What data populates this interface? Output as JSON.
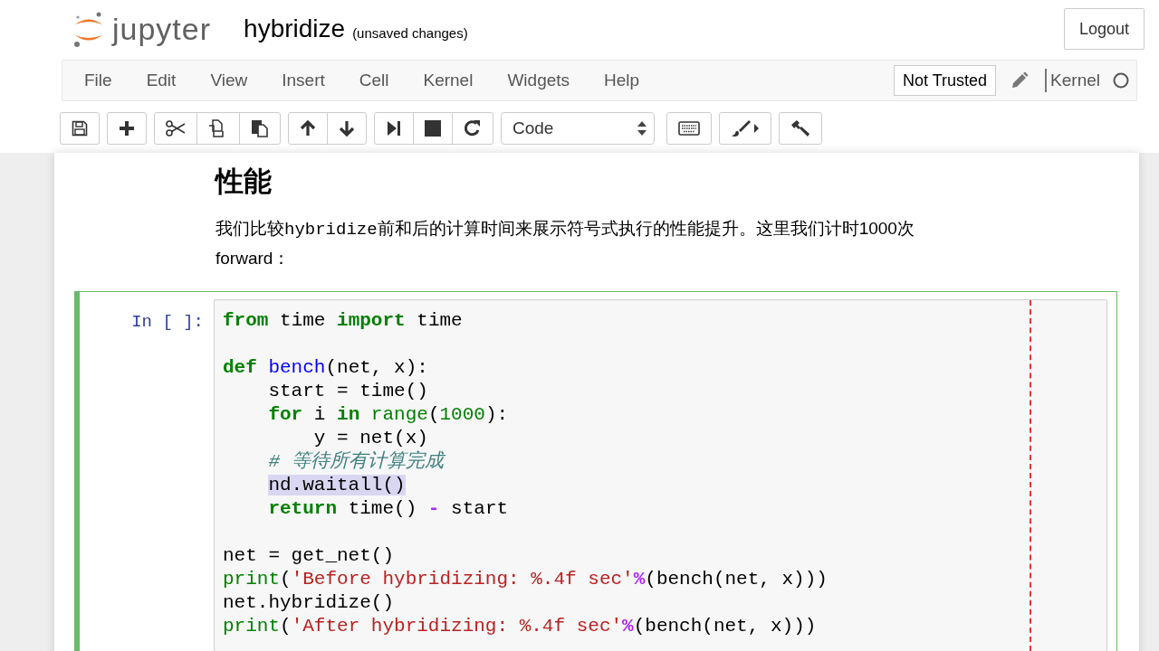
{
  "header": {
    "logo_text": "jupyter",
    "notebook_name": "hybridize",
    "save_status": "(unsaved changes)",
    "logout": "Logout"
  },
  "menubar": {
    "items": [
      "File",
      "Edit",
      "View",
      "Insert",
      "Cell",
      "Kernel",
      "Widgets",
      "Help"
    ],
    "trust": "Not Trusted",
    "kernel_name": "Kernel",
    "kernel_busy": false
  },
  "toolbar": {
    "cell_type": "Code"
  },
  "markdown": {
    "heading": "性能",
    "paragraph": [
      {
        "kind": "text",
        "text": "我们比较"
      },
      {
        "kind": "code",
        "text": "hybridize"
      },
      {
        "kind": "text",
        "text": "前和后的计算时间来展示符号式执行的性能提升。这里我们计时1000次forward："
      }
    ]
  },
  "code_cell": {
    "prompt": "In [ ]:",
    "selected": true,
    "lines": [
      {
        "kind": "code",
        "tokens": [
          {
            "kind": "keyword",
            "text": "from"
          },
          {
            "kind": "plain",
            "text": " time "
          },
          {
            "kind": "keyword",
            "text": "import"
          },
          {
            "kind": "plain",
            "text": " time"
          }
        ]
      },
      {
        "kind": "blank"
      },
      {
        "kind": "code",
        "tokens": [
          {
            "kind": "keyword",
            "text": "def"
          },
          {
            "kind": "defname",
            "text": " bench"
          },
          {
            "kind": "plain",
            "text": "(net, x):"
          }
        ],
        "children": [
          {
            "kind": "code",
            "tokens": [
              {
                "kind": "plain",
                "text": "start = time()"
              }
            ]
          },
          {
            "kind": "code",
            "tokens": [
              {
                "kind": "keyword",
                "text": "for"
              },
              {
                "kind": "plain",
                "text": " i "
              },
              {
                "kind": "keyword",
                "text": "in"
              },
              {
                "kind": "builtin",
                "text": " range"
              },
              {
                "kind": "plain",
                "text": "("
              },
              {
                "kind": "number",
                "text": "1000"
              },
              {
                "kind": "plain",
                "text": "):"
              }
            ],
            "children": [
              {
                "kind": "code",
                "tokens": [
                  {
                    "kind": "plain",
                    "text": "y = net(x)"
                  }
                ]
              }
            ]
          },
          {
            "kind": "code",
            "tokens": [
              {
                "kind": "comment",
                "text": "# 等待所有计算完成"
              }
            ]
          },
          {
            "kind": "code",
            "tokens": [
              {
                "kind": "selection",
                "text": "nd.waitall()"
              }
            ]
          },
          {
            "kind": "code",
            "tokens": [
              {
                "kind": "keyword",
                "text": "return"
              },
              {
                "kind": "plain",
                "text": " time() "
              },
              {
                "kind": "operator",
                "text": "-"
              },
              {
                "kind": "plain",
                "text": " start"
              }
            ]
          }
        ]
      },
      {
        "kind": "blank"
      },
      {
        "kind": "code",
        "tokens": [
          {
            "kind": "plain",
            "text": "net = get_net()"
          }
        ]
      },
      {
        "kind": "code",
        "tokens": [
          {
            "kind": "builtin",
            "text": "print"
          },
          {
            "kind": "plain",
            "text": "("
          },
          {
            "kind": "string",
            "text": "'Before hybridizing: %.4f sec'"
          },
          {
            "kind": "operator",
            "text": "%"
          },
          {
            "kind": "plain",
            "text": "(bench(net, x)))"
          }
        ]
      },
      {
        "kind": "code",
        "tokens": [
          {
            "kind": "plain",
            "text": "net.hybridize()"
          }
        ]
      },
      {
        "kind": "code",
        "tokens": [
          {
            "kind": "builtin",
            "text": "print"
          },
          {
            "kind": "plain",
            "text": "("
          },
          {
            "kind": "string",
            "text": "'After hybridizing: %.4f sec'"
          },
          {
            "kind": "operator",
            "text": "%"
          },
          {
            "kind": "plain",
            "text": "(bench(net, x)))"
          }
        ]
      }
    ]
  }
}
